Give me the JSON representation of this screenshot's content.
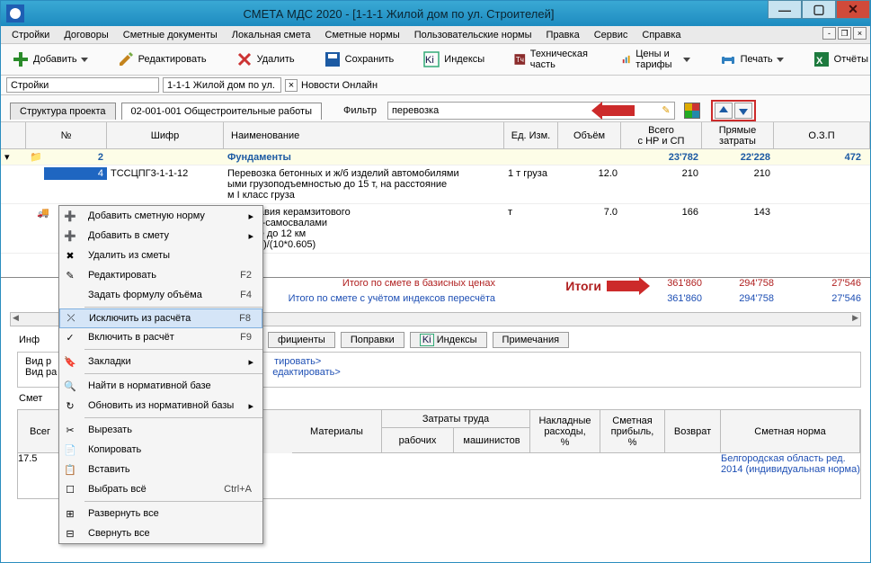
{
  "window": {
    "title": "СМЕТА МДС 2020   - [1-1-1 Жилой дом по ул. Строителей]"
  },
  "menu": [
    "Стройки",
    "Договоры",
    "Сметные документы",
    "Локальная смета",
    "Сметные нормы",
    "Пользовательские нормы",
    "Правка",
    "Сервис",
    "Справка"
  ],
  "mdi": {
    "min": "-",
    "max": "❐",
    "close": "×"
  },
  "toolbar": {
    "add": "Добавить",
    "edit": "Редактировать",
    "delete": "Удалить",
    "save": "Сохранить",
    "indexes": "Индексы",
    "tech": "Техническая часть",
    "prices": "Цены и тарифы",
    "print": "Печать",
    "reports": "Отчёты"
  },
  "breadcrumb": {
    "root": "Стройки",
    "doc": "1-1-1 Жилой дом по ул. Ст",
    "news": "Новости Онлайн"
  },
  "tabs": {
    "structure": "Структура проекта",
    "active": "02-001-001 Общестроительные работы"
  },
  "filter": {
    "label": "Фильтр",
    "value": "перевозка"
  },
  "grid_headers": {
    "n": "№",
    "code": "Шифр",
    "name": "Наименование",
    "unit": "Ед. Изм.",
    "vol": "Объём",
    "total": "Всего\nс НР и СП",
    "direct": "Прямые\nзатраты",
    "ozp": "О.З.П"
  },
  "rows": {
    "folder": {
      "n": "2",
      "name": "Фундаменты",
      "total": "23'782",
      "direct": "22'228",
      "ozp": "472"
    },
    "r1": {
      "n": "4",
      "code": "ТССЦПГ3-1-1-12",
      "name1": "Перевозка бетонных и ж/б изделий автомобилями",
      "name2": "ыми грузоподъемностью до 15 т, на расстояние",
      "name3": "м I класс груза",
      "unit": "1 т груза",
      "vol": "12.0",
      "total": "210",
      "direct": "210"
    },
    "r2": {
      "name1": "эзка гравия керамзитового",
      "name2": "билями-самосвалами",
      "name3": "стояние до 12 км",
      "name4": "5+20/60)/(10*0.605)",
      "unit": "т",
      "vol": "7.0",
      "total": "166",
      "direct": "143"
    }
  },
  "totals": {
    "label1": "Итого по смете в базисных ценах",
    "label2": "Итого по смете с учётом индексов пересчёта",
    "annot": "Итоги",
    "base": {
      "total": "361'860",
      "direct": "294'758",
      "ozp": "27'546"
    },
    "idx": {
      "total": "361'860",
      "direct": "294'758",
      "ozp": "27'546"
    }
  },
  "context_menu": [
    {
      "icon": "add",
      "label": "Добавить сметную норму",
      "sub": true
    },
    {
      "icon": "add",
      "label": "Добавить в смету",
      "sub": true
    },
    {
      "icon": "del",
      "label": "Удалить из сметы"
    },
    {
      "icon": "edit",
      "label": "Редактировать",
      "shortcut": "F2"
    },
    {
      "label": "Задать формулу объёма",
      "shortcut": "F4"
    },
    {
      "sep": true
    },
    {
      "icon": "excl",
      "label": "Исключить из расчёта",
      "shortcut": "F8",
      "highlight": true
    },
    {
      "icon": "incl",
      "label": "Включить в расчёт",
      "shortcut": "F9"
    },
    {
      "sep": true
    },
    {
      "icon": "bm",
      "label": "Закладки",
      "sub": true
    },
    {
      "sep": true
    },
    {
      "icon": "find",
      "label": "Найти в нормативной базе"
    },
    {
      "icon": "refr",
      "label": "Обновить из нормативной базы",
      "sub": true
    },
    {
      "sep": true
    },
    {
      "icon": "cut",
      "label": "Вырезать"
    },
    {
      "icon": "copy",
      "label": "Копировать"
    },
    {
      "icon": "paste",
      "label": "Вставить"
    },
    {
      "icon": "sel",
      "label": "Выбрать всё",
      "shortcut": "Ctrl+A"
    },
    {
      "sep": true
    },
    {
      "icon": "exp",
      "label": "Развернуть все"
    },
    {
      "icon": "col",
      "label": "Свернуть все"
    }
  ],
  "lower_tabs": {
    "inf": "Инф",
    "coeff": "фициенты",
    "corr": "Поправки",
    "idx": "Индексы",
    "notes": "Примечания",
    "idx_icon": "Ki"
  },
  "lower": {
    "workType": "Вид р",
    "resType": "Вид ра",
    "smet": "Смет",
    "edit1": "тировать>",
    "edit2": "едактировать>"
  },
  "table2": {
    "head": {
      "total": "Всег",
      "materials": "Материалы",
      "labor": "Затраты труда",
      "lab1": "рабочих",
      "lab2": "машинистов",
      "over": "Накладные\nрасходы,\n%",
      "profit": "Сметная\nприбыль,\n%",
      "ret": "Возврат",
      "norm": "Сметная норма"
    },
    "row": {
      "n": "17.5",
      "norm": "Белгородская область ред.\n2014  (индивидуальная норма)"
    }
  }
}
